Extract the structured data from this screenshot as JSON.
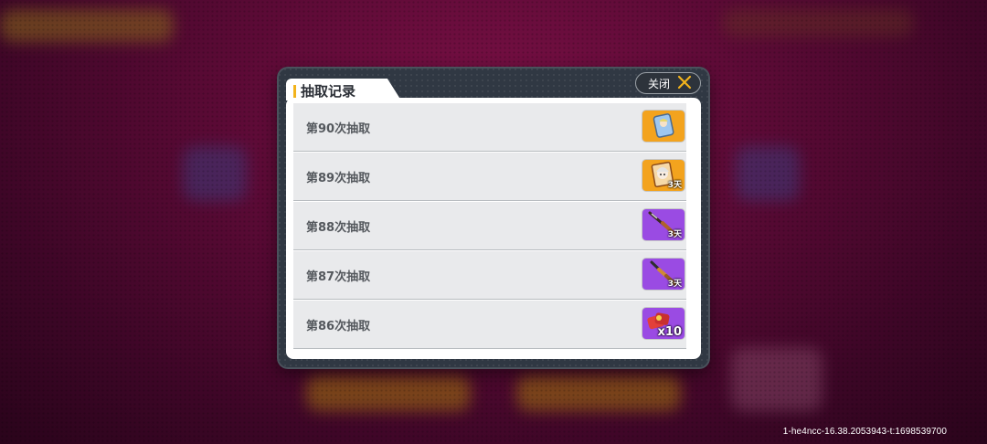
{
  "dialog": {
    "title": "抽取记录",
    "close_label": "关闭"
  },
  "records": [
    {
      "label": "第90次抽取",
      "item": "avatar-frame-icon",
      "rarity_color": "#f3a31e",
      "tag": ""
    },
    {
      "label": "第89次抽取",
      "item": "character-portrait-icon",
      "rarity_color": "#f3a31e",
      "tag": "3天"
    },
    {
      "label": "第88次抽取",
      "item": "rifle-icon",
      "rarity_color": "#9a4be3",
      "tag": "3天"
    },
    {
      "label": "第87次抽取",
      "item": "shotgun-icon",
      "rarity_color": "#9a4be3",
      "tag": "3天"
    },
    {
      "label": "第86次抽取",
      "item": "ammo-box-icon",
      "rarity_color": "#9a4be3",
      "tag": "x10"
    }
  ],
  "watermark": "1-he4ncc-16.38.2053943-t:1698539700",
  "colors": {
    "accent": "#f2b31c",
    "legendary": "#f3a31e",
    "epic": "#9a4be3",
    "dialog_bg": "#303843"
  }
}
